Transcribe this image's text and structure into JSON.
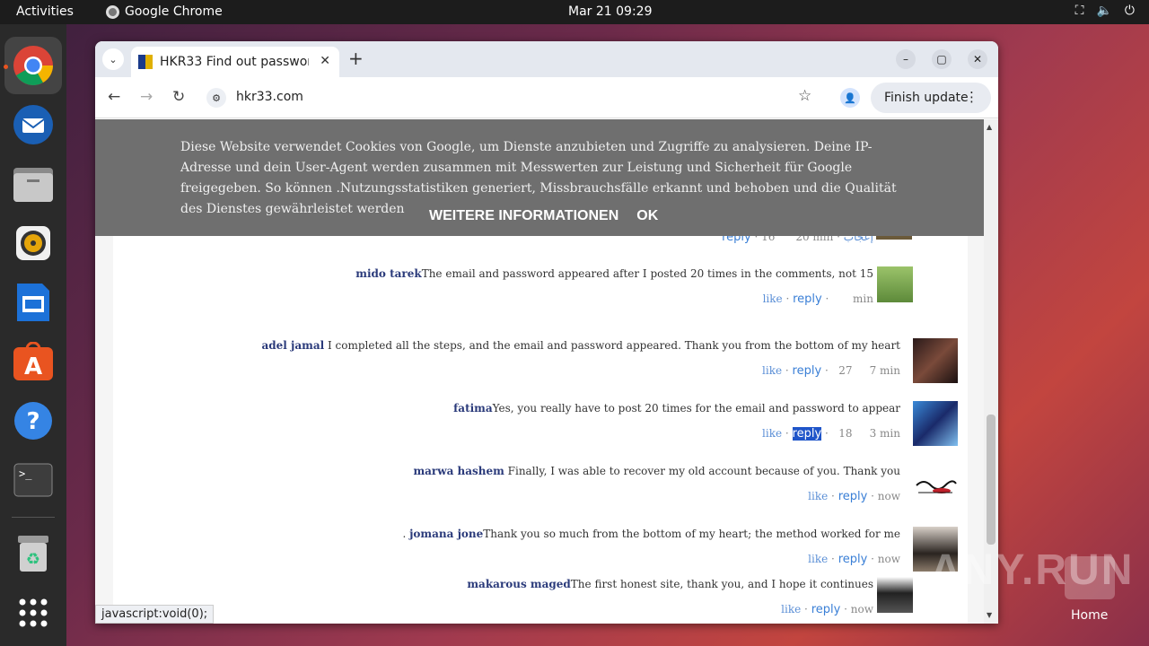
{
  "topbar": {
    "activities": "Activities",
    "app_name": "Google Chrome",
    "clock": "Mar 21  09:29"
  },
  "browser": {
    "tab_title": "HKR33 Find out passwor",
    "url": "hkr33.com",
    "finish_update": "Finish update",
    "status_url": "javascript:void(0);"
  },
  "cookie_banner": {
    "text": "Diese Website verwendet Cookies von Google, um Dienste anzubieten und Zugriffe zu analysieren. Deine IP-Adresse und dein User-Agent werden zusammen mit Messwerten zur Leistung und Sicherheit für Google freigegeben. So können .Nutzungsstatistiken generiert, Missbrauchsfälle erkannt und behoben und die Qualität des Dienstes gewährleistet werden",
    "more_info": "WEITERE INFORMATIONEN",
    "ok": "OK"
  },
  "partial_row": {
    "reply": "reply",
    "count": "16",
    "time": "20 min",
    "like": "إعجاب"
  },
  "comments": [
    {
      "name": "mido tarek",
      "text": "The email and password appeared after I posted 20 times in the comments, not 15",
      "like": "like",
      "reply": "reply",
      "count": "",
      "time": "min"
    },
    {
      "name": "adel jamal",
      "text": " I completed all the steps, and the email and password appeared. Thank you from the bottom of my heart",
      "like": "like",
      "reply": "reply",
      "count": "27",
      "time": "7 min"
    },
    {
      "name": "fatima",
      "text": "Yes, you really have to post 20 times for the email and password to appear",
      "like": "like",
      "reply": "reply",
      "count": "18",
      "time": "3 min"
    },
    {
      "name": "marwa hashem",
      "text": " Finally, I was able to recover my old account because of you. Thank you",
      "like": "like",
      "reply": "reply",
      "count": "",
      "time": "now"
    },
    {
      "name": "jomana jone",
      "prefix": ".  ",
      "text": "Thank you so much from the bottom of my heart; the method worked for me",
      "like": "like",
      "reply": "reply",
      "count": "",
      "time": "now"
    },
    {
      "name": "makarous maged",
      "text": "The first honest site, thank you, and I hope it continues",
      "like": "like",
      "reply": "reply",
      "count": "",
      "time": "now"
    }
  ],
  "desktop": {
    "watermark": "ANY.RUN",
    "home_label": "Home"
  }
}
